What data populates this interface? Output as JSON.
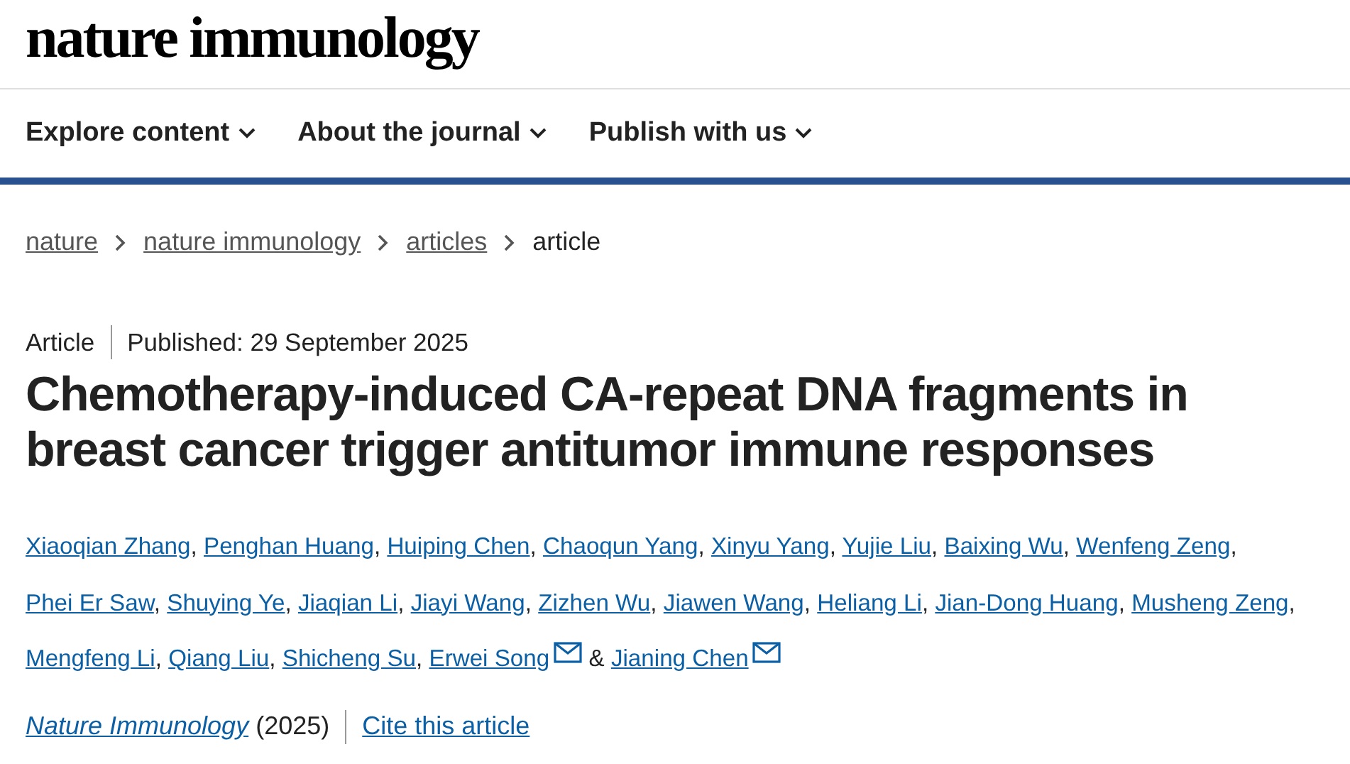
{
  "logo": "nature immunology",
  "nav": [
    {
      "label": "Explore content"
    },
    {
      "label": "About the journal"
    },
    {
      "label": "Publish with us"
    }
  ],
  "breadcrumbs": [
    {
      "label": "nature",
      "current": false
    },
    {
      "label": "nature immunology",
      "current": false
    },
    {
      "label": "articles",
      "current": false
    },
    {
      "label": "article",
      "current": true
    }
  ],
  "article": {
    "type": "Article",
    "published": "Published: 29 September 2025",
    "title": "Chemotherapy-induced CA-repeat DNA fragments in breast cancer trigger antitumor immune responses",
    "authors": [
      {
        "name": "Xiaoqian Zhang",
        "email": false,
        "after": ","
      },
      {
        "name": "Penghan Huang",
        "email": false,
        "after": ","
      },
      {
        "name": "Huiping Chen",
        "email": false,
        "after": ","
      },
      {
        "name": "Chaoqun Yang",
        "email": false,
        "after": ","
      },
      {
        "name": "Xinyu Yang",
        "email": false,
        "after": ","
      },
      {
        "name": "Yujie Liu",
        "email": false,
        "after": ","
      },
      {
        "name": "Baixing Wu",
        "email": false,
        "after": ","
      },
      {
        "name": "Wenfeng Zeng",
        "email": false,
        "after": ","
      },
      {
        "name": "Phei Er Saw",
        "email": false,
        "after": ","
      },
      {
        "name": "Shuying Ye",
        "email": false,
        "after": ","
      },
      {
        "name": "Jiaqian Li",
        "email": false,
        "after": ","
      },
      {
        "name": "Jiayi Wang",
        "email": false,
        "after": ","
      },
      {
        "name": "Zizhen Wu",
        "email": false,
        "after": ","
      },
      {
        "name": "Jiawen Wang",
        "email": false,
        "after": ","
      },
      {
        "name": "Heliang Li",
        "email": false,
        "after": ","
      },
      {
        "name": "Jian-Dong Huang",
        "email": false,
        "after": ","
      },
      {
        "name": "Musheng Zeng",
        "email": false,
        "after": ","
      },
      {
        "name": "Mengfeng Li",
        "email": false,
        "after": ","
      },
      {
        "name": "Qiang Liu",
        "email": false,
        "after": ","
      },
      {
        "name": "Shicheng Su",
        "email": false,
        "after": ","
      },
      {
        "name": "Erwei Song",
        "email": true,
        "after": "&"
      },
      {
        "name": "Jianing Chen",
        "email": true
      }
    ],
    "journal": "Nature Immunology",
    "year": "(2025)",
    "cite": "Cite this article"
  }
}
